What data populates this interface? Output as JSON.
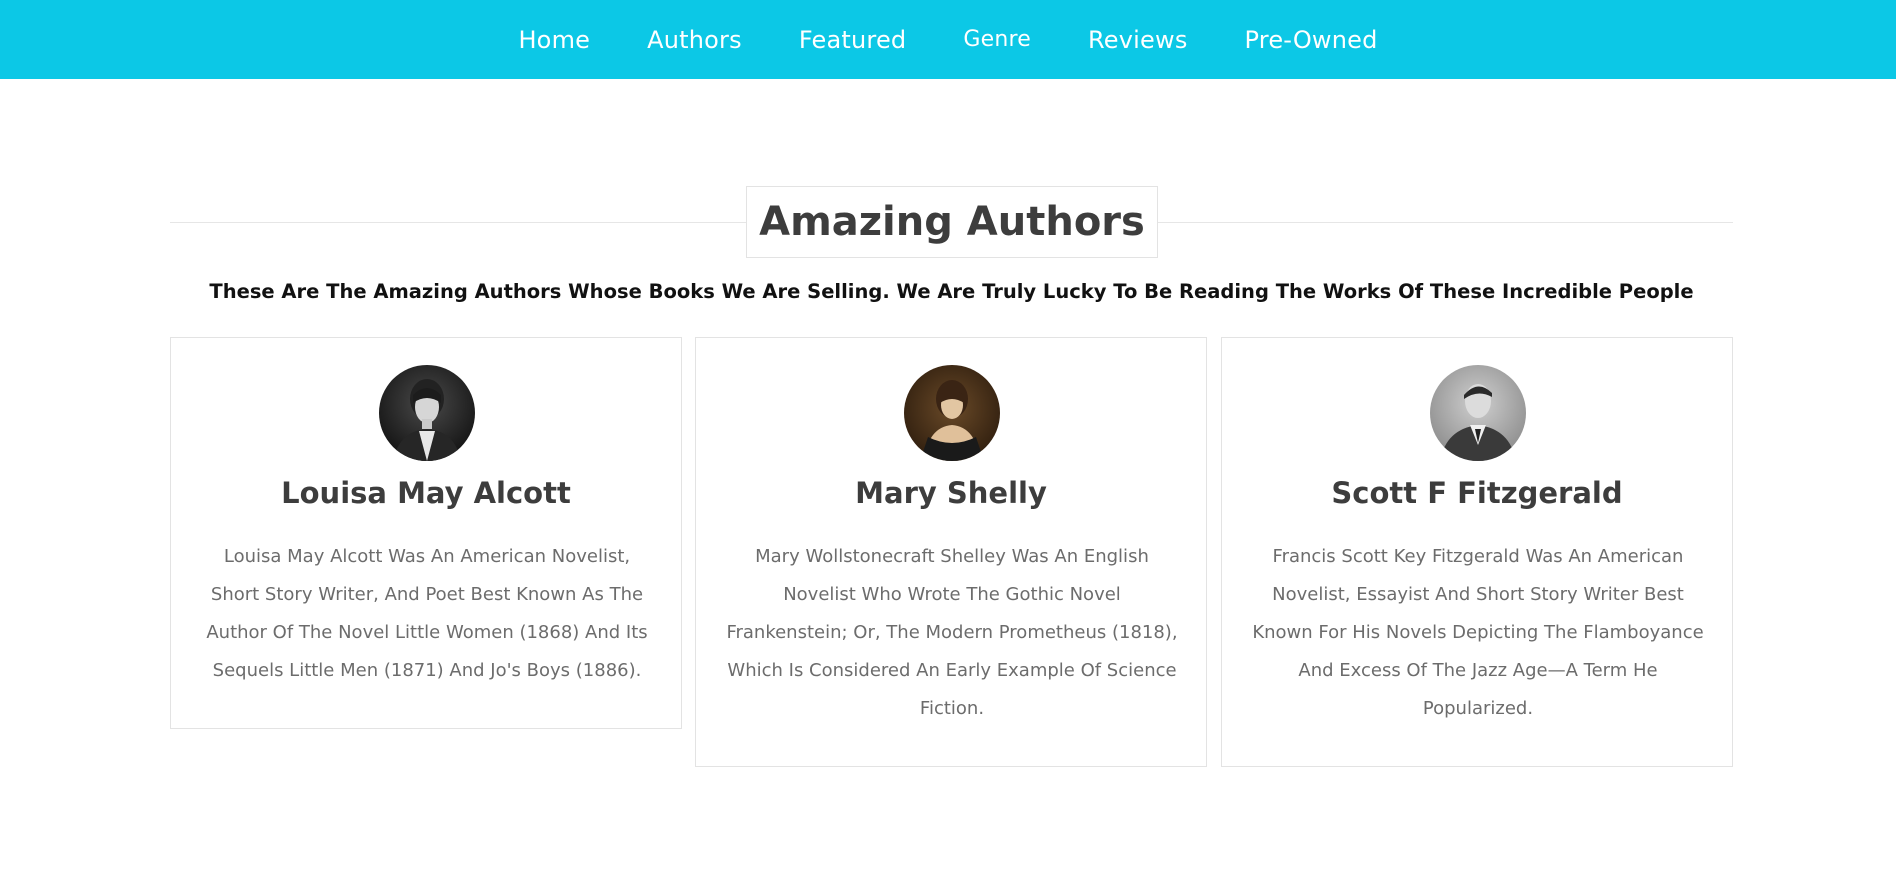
{
  "nav": {
    "items": [
      {
        "label": "Home"
      },
      {
        "label": "Authors"
      },
      {
        "label": "Featured"
      },
      {
        "label": "Genre"
      },
      {
        "label": "Reviews"
      },
      {
        "label": "Pre-Owned"
      }
    ]
  },
  "section": {
    "title": "Amazing Authors",
    "subtitle": "These Are The Amazing Authors Whose Books We Are Selling. We Are Truly Lucky To Be Reading The Works Of These Incredible People"
  },
  "authors": [
    {
      "name": "Louisa May Alcott",
      "bio": "Louisa May Alcott Was An American Novelist, Short Story Writer, And Poet Best Known As The Author Of The Novel Little Women (1868) And Its Sequels Little Men (1871) And Jo's Boys (1886)."
    },
    {
      "name": "Mary Shelly",
      "bio": "Mary Wollstonecraft Shelley Was An English Novelist Who Wrote The Gothic Novel Frankenstein; Or, The Modern Prometheus (1818), Which Is Considered An Early Example Of Science Fiction."
    },
    {
      "name": "Scott F Fitzgerald",
      "bio": "Francis Scott Key Fitzgerald Was An American Novelist, Essayist And Short Story Writer Best Known For His Novels Depicting The Flamboyance And Excess Of The Jazz Age—A Term He Popularized."
    }
  ],
  "colors": {
    "nav_background": "#0cc8e6",
    "heading_text": "#3d3d3d",
    "body_text": "#6c6c6c",
    "border": "#e3e3e3"
  }
}
